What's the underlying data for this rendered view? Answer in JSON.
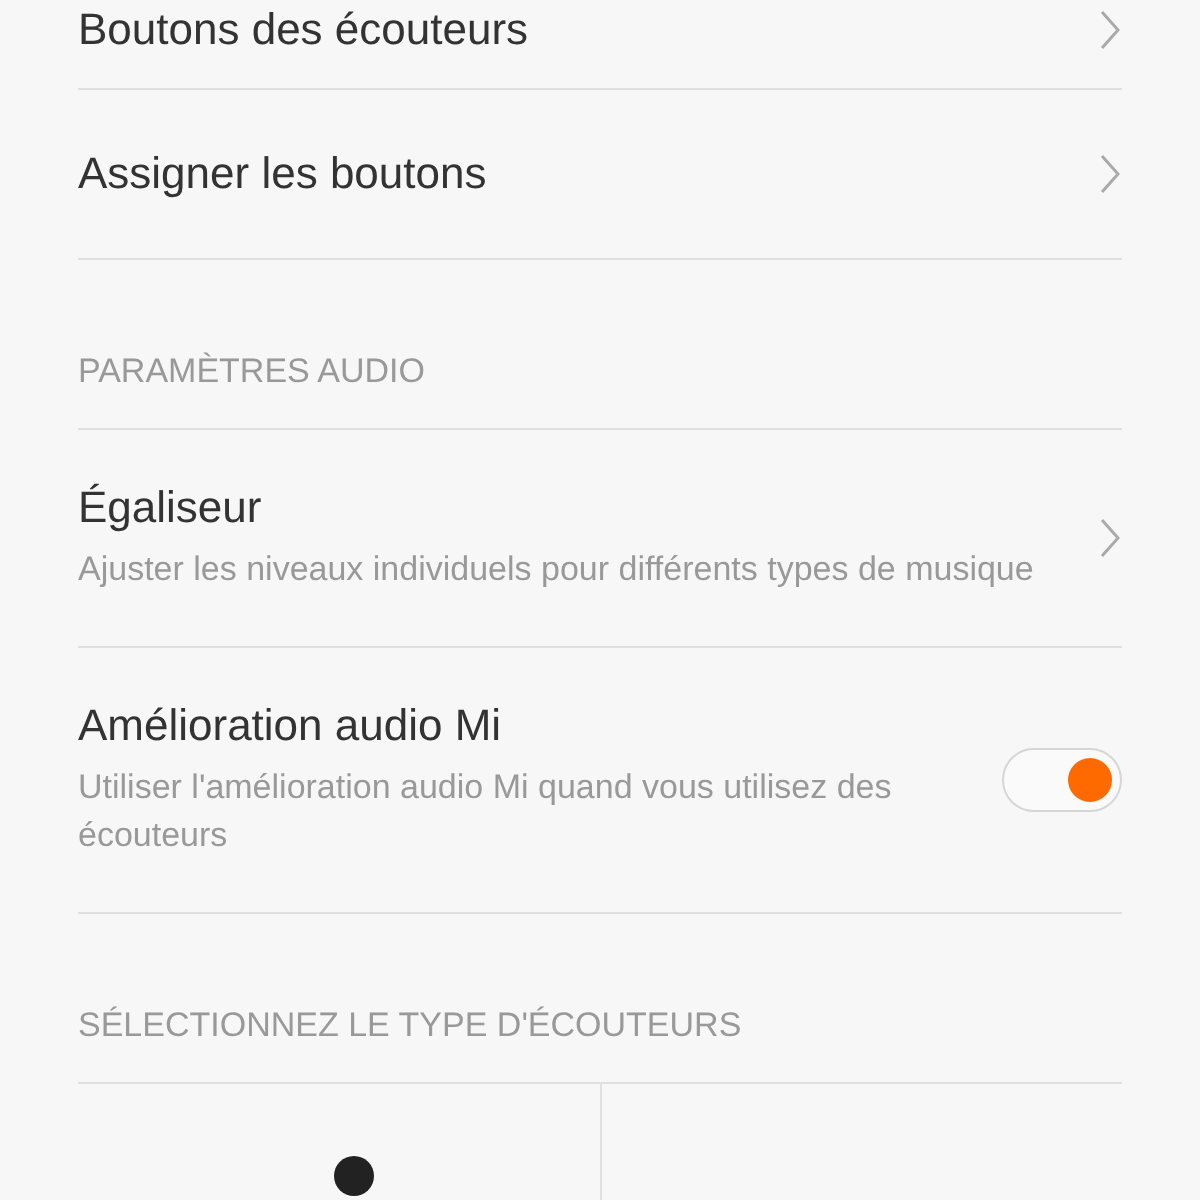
{
  "items": [
    {
      "kind": "link",
      "title": "Boutons des écouteurs"
    },
    {
      "kind": "link",
      "title": "Assigner les boutons"
    },
    {
      "kind": "header",
      "title": "PARAMÈTRES AUDIO"
    },
    {
      "kind": "link",
      "title": "Égaliseur",
      "subtitle": "Ajuster les niveaux individuels pour différents types de musique"
    },
    {
      "kind": "toggle",
      "title": "Amélioration audio Mi",
      "subtitle": "Utiliser l'amélioration audio Mi quand vous utilisez des écouteurs",
      "on": true
    },
    {
      "kind": "header",
      "title": "SÉLECTIONNEZ LE TYPE D'ÉCOUTEURS"
    }
  ]
}
